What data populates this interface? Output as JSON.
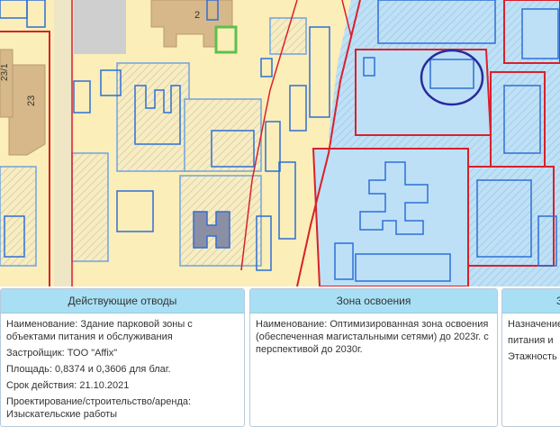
{
  "map": {
    "labels": [
      "2",
      "23",
      "23/1"
    ],
    "colors": {
      "base": "#fbeeb8",
      "water": "#bde0f7",
      "parcel_outline": "#2f6fd6",
      "zone_border": "#d9202b",
      "road": "#c9c9c9",
      "building": "#d6b88a",
      "green": "#5dc04f",
      "highlight_circle": "#2a2a9c"
    }
  },
  "panels": [
    {
      "title": "Действующие отводы",
      "lines": [
        "Наименование: Здание парковой зоны с объектами питания и обслуживания",
        "Застройщик: ТОО \"Affix\"",
        "Площадь: 0,8374 и 0,3606 для благ.",
        "Срок действия: 21.10.2021",
        "Проектирование/строительство/аренда: Изыскательские работы"
      ]
    },
    {
      "title": "Зона освоения",
      "lines": [
        "Наименование: Оптимизированная зона освоения (обеспеченная магистальными сетями) до 2023г. с перспективой до 2030г."
      ]
    },
    {
      "title": "Зд",
      "lines": [
        "Назначение",
        "питания и",
        "Этажность"
      ]
    }
  ]
}
